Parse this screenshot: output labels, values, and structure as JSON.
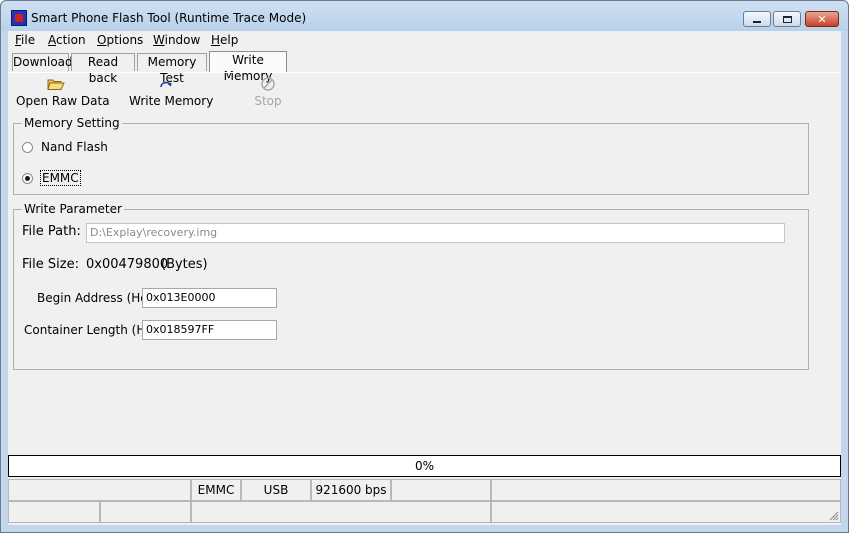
{
  "window": {
    "title": "Smart Phone Flash Tool (Runtime Trace Mode)"
  },
  "menu": [
    {
      "label": "File"
    },
    {
      "label": "Action"
    },
    {
      "label": "Options"
    },
    {
      "label": "Window"
    },
    {
      "label": "Help"
    }
  ],
  "tabs": [
    {
      "label": "Download"
    },
    {
      "label": "Read back"
    },
    {
      "label": "Memory Test"
    },
    {
      "label": "Write Memory",
      "active": true
    }
  ],
  "toolbar": {
    "open_raw_data": "Open Raw Data",
    "write_memory": "Write Memory",
    "stop": "Stop"
  },
  "memory_setting": {
    "title": "Memory Setting",
    "nand_flash": "Nand Flash",
    "emmc": "EMMC",
    "selected": "EMMC"
  },
  "write_parameter": {
    "title": "Write Parameter",
    "file_path_label": "File Path:",
    "file_path_value": "D:\\Explay\\recovery.img",
    "file_size_label": "File Size:",
    "file_size_value": "0x00479800",
    "file_size_unit": "(Bytes)",
    "begin_address_label": "Begin Address (Hex) :",
    "begin_address_value": "0x013E0000",
    "container_length_label": "Container Length (Hex) :",
    "container_length_value": "0x018597FF"
  },
  "progress": {
    "text": "0%",
    "value": 0
  },
  "status": {
    "memory": "EMMC",
    "interface": "USB",
    "baud": "921600 bps"
  }
}
